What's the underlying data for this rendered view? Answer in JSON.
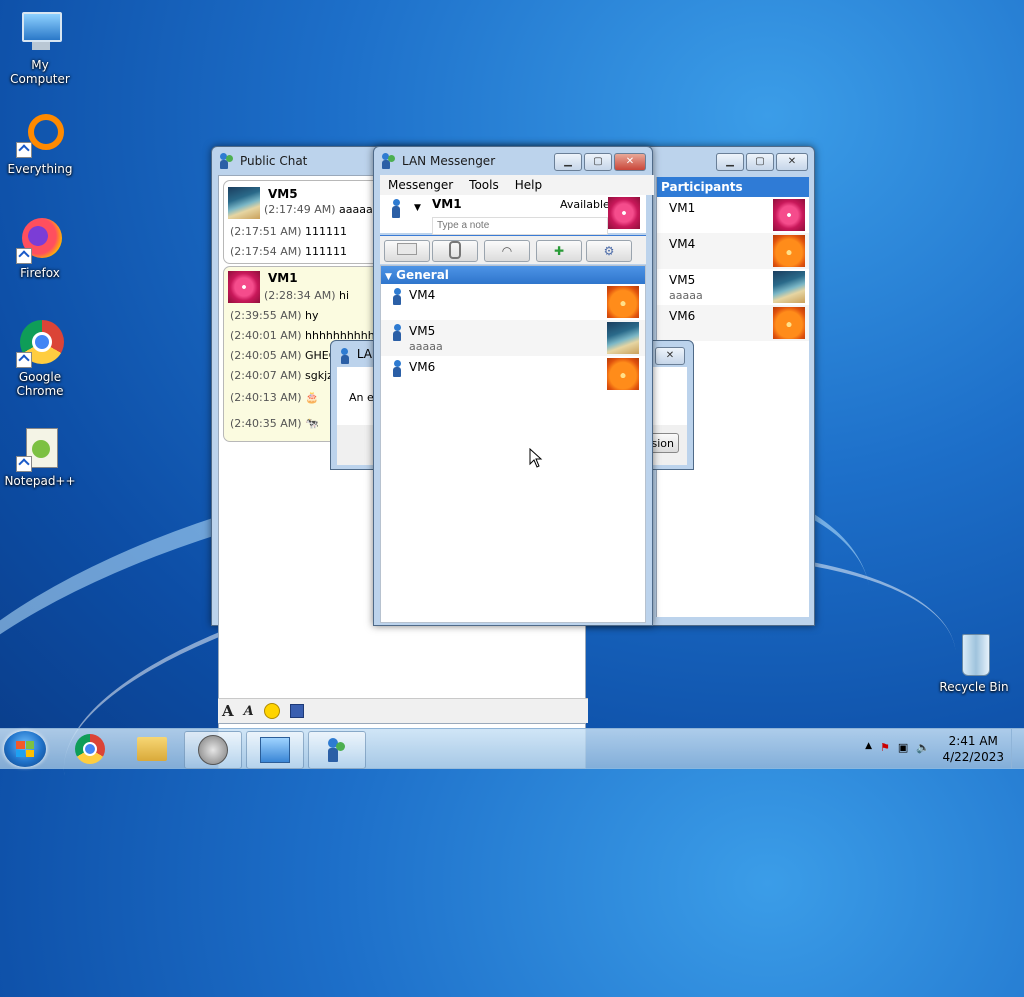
{
  "desktop": {
    "icons": [
      {
        "label": "My Computer"
      },
      {
        "label": "Everything"
      },
      {
        "label": "Firefox"
      },
      {
        "label": "Google Chrome"
      },
      {
        "label": "Notepad++"
      },
      {
        "label": "Recycle Bin"
      }
    ]
  },
  "public_chat": {
    "title": "Public Chat",
    "groups": [
      {
        "sender": "VM5",
        "lines": [
          {
            "time": "(2:17:49 AM)",
            "text": "aaaaa"
          },
          {
            "time": "(2:17:51 AM)",
            "text": "111111"
          },
          {
            "time": "(2:17:54 AM)",
            "text": "111111"
          }
        ]
      },
      {
        "sender": "VM1",
        "lines": [
          {
            "time": "(2:28:34 AM)",
            "text": "hi"
          },
          {
            "time": "(2:39:55 AM)",
            "text": "hy"
          },
          {
            "time": "(2:40:01 AM)",
            "text": "hhhhhhhhhhhh"
          },
          {
            "time": "(2:40:05 AM)",
            "text": "GHEO"
          },
          {
            "time": "(2:40:07 AM)",
            "text": "sgkjzf"
          },
          {
            "time": "(2:40:13 AM)",
            "text": "🎂"
          },
          {
            "time": "(2:40:35 AM)",
            "text": "🐄"
          }
        ]
      }
    ],
    "toolbar": {
      "font_icon": "A",
      "font_style_icon": "A"
    }
  },
  "participants": {
    "header": "Participants",
    "items": [
      {
        "name": "VM1",
        "note": ""
      },
      {
        "name": "VM4",
        "note": ""
      },
      {
        "name": "VM5",
        "note": "aaaaa"
      },
      {
        "name": "VM6",
        "note": ""
      }
    ]
  },
  "dialog": {
    "title": "LA",
    "body": "An er",
    "button": "rsion"
  },
  "lan_messenger": {
    "title": "LAN Messenger",
    "menu": [
      "Messenger",
      "Tools",
      "Help"
    ],
    "user": {
      "name": "VM1",
      "status": "Available",
      "note_placeholder": "Type a note"
    },
    "group": "General",
    "contacts": [
      {
        "name": "VM4",
        "note": ""
      },
      {
        "name": "VM5",
        "note": "aaaaa"
      },
      {
        "name": "VM6",
        "note": ""
      }
    ]
  },
  "taskbar": {
    "clock_time": "2:41 AM",
    "clock_date": "4/22/2023"
  },
  "colors": {
    "accent": "#2f7bd6",
    "chat_bubble_yellow": "#fbfbe0"
  }
}
